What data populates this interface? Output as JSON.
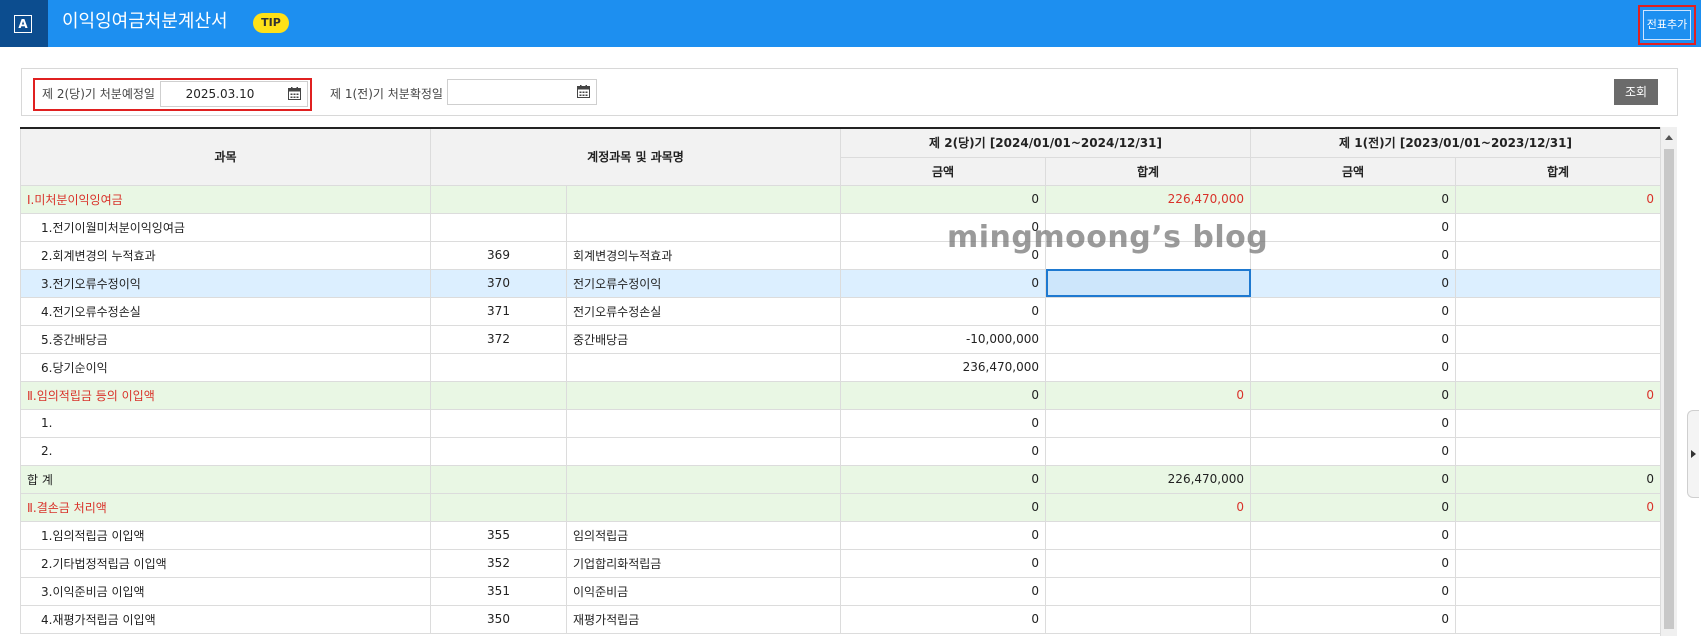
{
  "header": {
    "logo_letter": "A",
    "title": "이익잉여금처분계산서",
    "tip_label": "TIP",
    "add_voucher_label": "전표추가"
  },
  "filters": {
    "current_label": "제 2(당)기  처분예정일",
    "current_date": "2025.03.10",
    "prior_label": "제 1(전)기  처분확정일",
    "prior_date": "",
    "search_label": "조회"
  },
  "table": {
    "headers": {
      "subject": "과목",
      "account": "계정과목 및 과목명",
      "current_period": "제 2(당)기 [2024/01/01~2024/12/31]",
      "prior_period": "제 1(전)기 [2023/01/01~2023/12/31]",
      "amount": "금액",
      "total": "합계"
    },
    "rows": [
      {
        "subject": "Ⅰ.미처분이익잉여금",
        "code": "",
        "account": "",
        "cur_amount": "0",
        "cur_total": "226,470,000",
        "pri_amount": "0",
        "pri_total": "0",
        "type": "section"
      },
      {
        "subject": "1.전기이월미처분이익잉여금",
        "code": "",
        "account": "",
        "cur_amount": "0",
        "cur_total": "",
        "pri_amount": "0",
        "pri_total": "",
        "type": "item"
      },
      {
        "subject": "2.회계변경의 누적효과",
        "code": "369",
        "account": "회계변경의누적효과",
        "cur_amount": "0",
        "cur_total": "",
        "pri_amount": "0",
        "pri_total": "",
        "type": "item"
      },
      {
        "subject": "3.전기오류수정이익",
        "code": "370",
        "account": "전기오류수정이익",
        "cur_amount": "0",
        "cur_total": "",
        "pri_amount": "0",
        "pri_total": "",
        "type": "selected"
      },
      {
        "subject": "4.전기오류수정손실",
        "code": "371",
        "account": "전기오류수정손실",
        "cur_amount": "0",
        "cur_total": "",
        "pri_amount": "0",
        "pri_total": "",
        "type": "item"
      },
      {
        "subject": "5.중간배당금",
        "code": "372",
        "account": "중간배당금",
        "cur_amount": "-10,000,000",
        "cur_total": "",
        "pri_amount": "0",
        "pri_total": "",
        "type": "item"
      },
      {
        "subject": "6.당기순이익",
        "code": "",
        "account": "",
        "cur_amount": "236,470,000",
        "cur_total": "",
        "pri_amount": "0",
        "pri_total": "",
        "type": "item"
      },
      {
        "subject": "Ⅱ.임의적립금 등의 이입액",
        "code": "",
        "account": "",
        "cur_amount": "0",
        "cur_total": "0",
        "pri_amount": "0",
        "pri_total": "0",
        "type": "section"
      },
      {
        "subject": "1.",
        "code": "",
        "account": "",
        "cur_amount": "0",
        "cur_total": "",
        "pri_amount": "0",
        "pri_total": "",
        "type": "item"
      },
      {
        "subject": "2.",
        "code": "",
        "account": "",
        "cur_amount": "0",
        "cur_total": "",
        "pri_amount": "0",
        "pri_total": "",
        "type": "item"
      },
      {
        "subject": "합 계",
        "code": "",
        "account": "",
        "cur_amount": "0",
        "cur_total": "226,470,000",
        "pri_amount": "0",
        "pri_total": "0",
        "type": "sum"
      },
      {
        "subject": "Ⅱ.결손금 처리액",
        "code": "",
        "account": "",
        "cur_amount": "0",
        "cur_total": "0",
        "pri_amount": "0",
        "pri_total": "0",
        "type": "section"
      },
      {
        "subject": "1.임의적립금 이입액",
        "code": "355",
        "account": "임의적립금",
        "cur_amount": "0",
        "cur_total": "",
        "pri_amount": "0",
        "pri_total": "",
        "type": "item"
      },
      {
        "subject": "2.기타법정적립금 이입액",
        "code": "352",
        "account": "기업합리화적립금",
        "cur_amount": "0",
        "cur_total": "",
        "pri_amount": "0",
        "pri_total": "",
        "type": "item"
      },
      {
        "subject": "3.이익준비금 이입액",
        "code": "351",
        "account": "이익준비금",
        "cur_amount": "0",
        "cur_total": "",
        "pri_amount": "0",
        "pri_total": "",
        "type": "item"
      },
      {
        "subject": "4.재평가적립금 이입액",
        "code": "350",
        "account": "재평가적립금",
        "cur_amount": "0",
        "cur_total": "",
        "pri_amount": "0",
        "pri_total": "",
        "type": "item"
      }
    ]
  },
  "watermark": "mingmoong’s blog",
  "colors": {
    "header_bg": "#1d8ff0",
    "section_bg": "#e9f7e4",
    "selected_bg": "#dcefff",
    "accent_red": "#d9322a",
    "tip_yellow": "#ffe118"
  }
}
